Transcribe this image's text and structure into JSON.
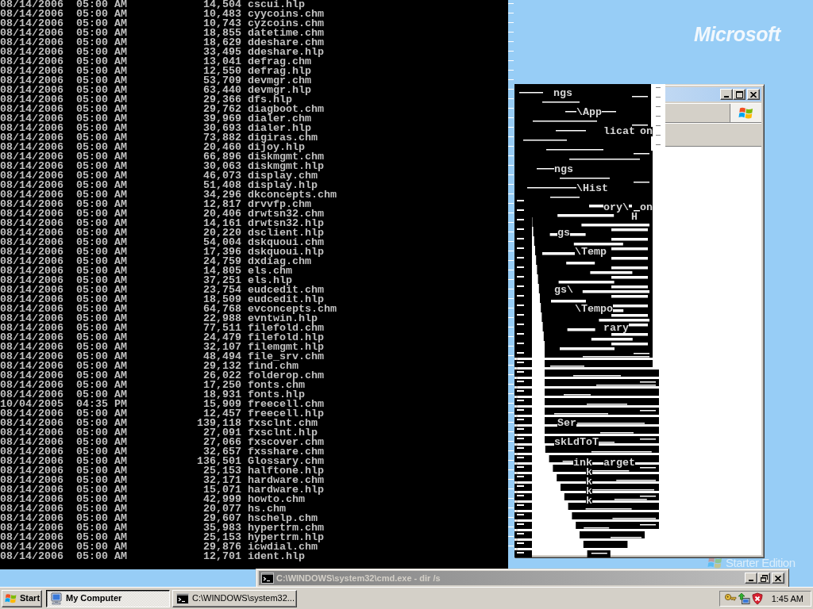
{
  "console": {
    "rows": [
      {
        "date": "08/14/2006",
        "time": "05:00 AM",
        "size": "14,504",
        "name": "cscui.hlp"
      },
      {
        "date": "08/14/2006",
        "time": "05:00 AM",
        "size": "10,483",
        "name": "cyycoins.chm"
      },
      {
        "date": "08/14/2006",
        "time": "05:00 AM",
        "size": "10,743",
        "name": "cyzcoins.chm"
      },
      {
        "date": "08/14/2006",
        "time": "05:00 AM",
        "size": "18,855",
        "name": "datetime.chm"
      },
      {
        "date": "08/14/2006",
        "time": "05:00 AM",
        "size": "18,629",
        "name": "ddeshare.chm"
      },
      {
        "date": "08/14/2006",
        "time": "05:00 AM",
        "size": "33,495",
        "name": "ddeshare.hlp"
      },
      {
        "date": "08/14/2006",
        "time": "05:00 AM",
        "size": "13,041",
        "name": "defrag.chm"
      },
      {
        "date": "08/14/2006",
        "time": "05:00 AM",
        "size": "12,550",
        "name": "defrag.hlp"
      },
      {
        "date": "08/14/2006",
        "time": "05:00 AM",
        "size": "53,709",
        "name": "devmgr.chm"
      },
      {
        "date": "08/14/2006",
        "time": "05:00 AM",
        "size": "63,440",
        "name": "devmgr.hlp"
      },
      {
        "date": "08/14/2006",
        "time": "05:00 AM",
        "size": "29,366",
        "name": "dfs.hlp"
      },
      {
        "date": "08/14/2006",
        "time": "05:00 AM",
        "size": "29,762",
        "name": "diagboot.chm"
      },
      {
        "date": "08/14/2006",
        "time": "05:00 AM",
        "size": "39,969",
        "name": "dialer.chm"
      },
      {
        "date": "08/14/2006",
        "time": "05:00 AM",
        "size": "30,693",
        "name": "dialer.hlp"
      },
      {
        "date": "08/14/2006",
        "time": "05:00 AM",
        "size": "73,882",
        "name": "digiras.chm"
      },
      {
        "date": "08/14/2006",
        "time": "05:00 AM",
        "size": "20,460",
        "name": "dijoy.hlp"
      },
      {
        "date": "08/14/2006",
        "time": "05:00 AM",
        "size": "66,896",
        "name": "diskmgmt.chm"
      },
      {
        "date": "08/14/2006",
        "time": "05:00 AM",
        "size": "30,063",
        "name": "diskmgmt.hlp"
      },
      {
        "date": "08/14/2006",
        "time": "05:00 AM",
        "size": "46,073",
        "name": "display.chm"
      },
      {
        "date": "08/14/2006",
        "time": "05:00 AM",
        "size": "51,408",
        "name": "display.hlp"
      },
      {
        "date": "08/14/2006",
        "time": "05:00 AM",
        "size": "34,296",
        "name": "dkconcepts.chm"
      },
      {
        "date": "08/14/2006",
        "time": "05:00 AM",
        "size": "12,817",
        "name": "drvvfp.chm"
      },
      {
        "date": "08/14/2006",
        "time": "05:00 AM",
        "size": "20,406",
        "name": "drwtsn32.chm"
      },
      {
        "date": "08/14/2006",
        "time": "05:00 AM",
        "size": "14,161",
        "name": "drwtsn32.hlp"
      },
      {
        "date": "08/14/2006",
        "time": "05:00 AM",
        "size": "20,220",
        "name": "dsclient.hlp"
      },
      {
        "date": "08/14/2006",
        "time": "05:00 AM",
        "size": "54,004",
        "name": "dskquoui.chm"
      },
      {
        "date": "08/14/2006",
        "time": "05:00 AM",
        "size": "17,396",
        "name": "dskquoui.hlp"
      },
      {
        "date": "08/14/2006",
        "time": "05:00 AM",
        "size": "24,759",
        "name": "dxdiag.chm"
      },
      {
        "date": "08/14/2006",
        "time": "05:00 AM",
        "size": "14,805",
        "name": "els.chm"
      },
      {
        "date": "08/14/2006",
        "time": "05:00 AM",
        "size": "37,251",
        "name": "els.hlp"
      },
      {
        "date": "08/14/2006",
        "time": "05:00 AM",
        "size": "23,754",
        "name": "eudcedit.chm"
      },
      {
        "date": "08/14/2006",
        "time": "05:00 AM",
        "size": "18,509",
        "name": "eudcedit.hlp"
      },
      {
        "date": "08/14/2006",
        "time": "05:00 AM",
        "size": "64,768",
        "name": "evconcepts.chm"
      },
      {
        "date": "08/14/2006",
        "time": "05:00 AM",
        "size": "22,988",
        "name": "evntwin.hlp"
      },
      {
        "date": "08/14/2006",
        "time": "05:00 AM",
        "size": "77,511",
        "name": "filefold.chm"
      },
      {
        "date": "08/14/2006",
        "time": "05:00 AM",
        "size": "24,479",
        "name": "filefold.hlp"
      },
      {
        "date": "08/14/2006",
        "time": "05:00 AM",
        "size": "32,107",
        "name": "filemgmt.hlp"
      },
      {
        "date": "08/14/2006",
        "time": "05:00 AM",
        "size": "48,494",
        "name": "file_srv.chm"
      },
      {
        "date": "08/14/2006",
        "time": "05:00 AM",
        "size": "29,132",
        "name": "find.chm"
      },
      {
        "date": "08/14/2006",
        "time": "05:00 AM",
        "size": "26,022",
        "name": "folderop.chm"
      },
      {
        "date": "08/14/2006",
        "time": "05:00 AM",
        "size": "17,250",
        "name": "fonts.chm"
      },
      {
        "date": "08/14/2006",
        "time": "05:00 AM",
        "size": "18,931",
        "name": "fonts.hlp"
      },
      {
        "date": "10/04/2005",
        "time": "04:35 PM",
        "size": "15,909",
        "name": "freecell.chm"
      },
      {
        "date": "08/14/2006",
        "time": "05:00 AM",
        "size": "12,457",
        "name": "freecell.hlp"
      },
      {
        "date": "08/14/2006",
        "time": "05:00 AM",
        "size": "139,118",
        "name": "fxsclnt.chm"
      },
      {
        "date": "08/14/2006",
        "time": "05:00 AM",
        "size": "27,091",
        "name": "fxsclnt.hlp"
      },
      {
        "date": "08/14/2006",
        "time": "05:00 AM",
        "size": "27,066",
        "name": "fxscover.chm"
      },
      {
        "date": "08/14/2006",
        "time": "05:00 AM",
        "size": "32,657",
        "name": "fxsshare.chm"
      },
      {
        "date": "08/14/2006",
        "time": "05:00 AM",
        "size": "136,501",
        "name": "Glossary.chm"
      },
      {
        "date": "08/14/2006",
        "time": "05:00 AM",
        "size": "25,153",
        "name": "halftone.hlp"
      },
      {
        "date": "08/14/2006",
        "time": "05:00 AM",
        "size": "32,171",
        "name": "hardware.chm"
      },
      {
        "date": "08/14/2006",
        "time": "05:00 AM",
        "size": "15,071",
        "name": "hardware.hlp"
      },
      {
        "date": "08/14/2006",
        "time": "05:00 AM",
        "size": "42,999",
        "name": "howto.chm"
      },
      {
        "date": "08/14/2006",
        "time": "05:00 AM",
        "size": "20,077",
        "name": "hs.chm"
      },
      {
        "date": "08/14/2006",
        "time": "05:00 AM",
        "size": "29,607",
        "name": "hschelp.chm"
      },
      {
        "date": "08/14/2006",
        "time": "05:00 AM",
        "size": "35,983",
        "name": "hypertrm.chm"
      },
      {
        "date": "08/14/2006",
        "time": "05:00 AM",
        "size": "25,153",
        "name": "hypertrm.hlp"
      },
      {
        "date": "08/14/2006",
        "time": "05:00 AM",
        "size": "29,876",
        "name": "icwdial.chm"
      },
      {
        "date": "08/14/2006",
        "time": "05:00 AM",
        "size": "12,701",
        "name": "ident.hlp"
      }
    ]
  },
  "desktop": {
    "logo": "Microsoft",
    "edition": "Starter Edition"
  },
  "garbled_window": {
    "fragments": [
      "ngs",
      "\\App",
      "licat",
      "on",
      "ngs",
      "\\Hist",
      "ory\\",
      "on",
      "H",
      "gs",
      "\\Temp",
      "gs\\",
      "\\Tempo",
      "rary",
      "Ser",
      "skLdToT",
      "ink",
      "arget",
      "k",
      "k",
      "k",
      "k"
    ]
  },
  "console_title_bar": {
    "title": "C:\\WINDOWS\\system32\\cmd.exe - dir /s"
  },
  "taskbar": {
    "start": "Start",
    "buttons": [
      {
        "label": "My Computer",
        "selected": true,
        "kind": "computer"
      },
      {
        "label": "C:\\WINDOWS\\system32...",
        "selected": false,
        "kind": "console"
      }
    ],
    "clock": "1:45 AM"
  }
}
